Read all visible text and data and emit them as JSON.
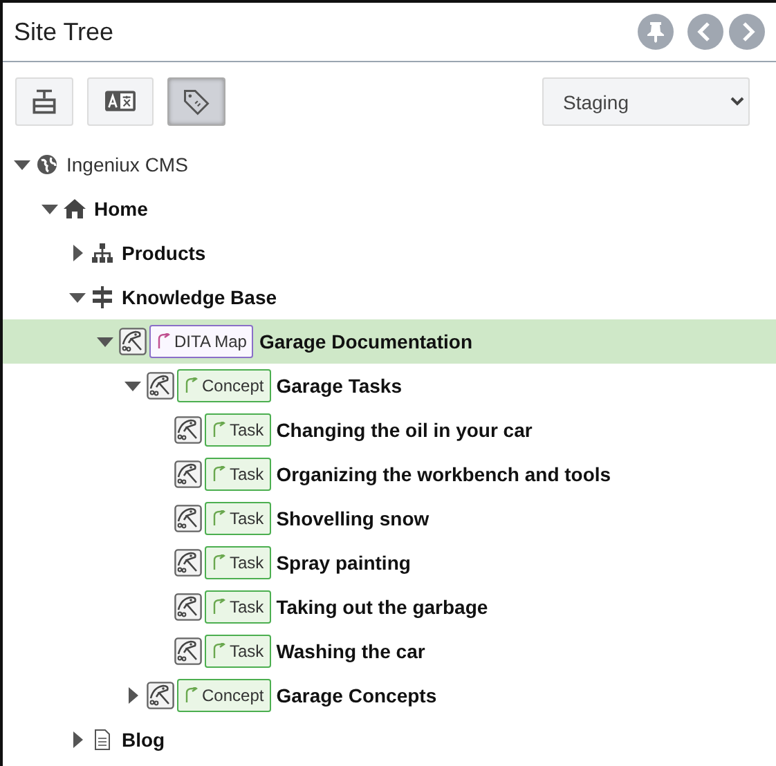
{
  "panel": {
    "title": "Site Tree"
  },
  "toolbar": {
    "buttons": [
      {
        "kind": "structure",
        "selected": false
      },
      {
        "kind": "translate",
        "selected": false
      },
      {
        "kind": "tag",
        "selected": true
      }
    ],
    "environment": {
      "value": "Staging"
    }
  },
  "tree": [
    {
      "label": "Ingeniux CMS",
      "kind": "site",
      "expanded": true,
      "selected": false,
      "children": [
        {
          "label": "Home",
          "kind": "home",
          "expanded": true,
          "selected": false,
          "children": [
            {
              "label": "Products",
              "kind": "sitemap",
              "expanded": false,
              "selected": false
            },
            {
              "label": "Knowledge Base",
              "kind": "signpost",
              "expanded": true,
              "selected": false,
              "children": [
                {
                  "label": "Garage Documentation",
                  "kind": "dita",
                  "badge": {
                    "label": "DITA Map",
                    "kind": "map"
                  },
                  "expanded": true,
                  "selected": true,
                  "children": [
                    {
                      "label": "Garage Tasks",
                      "kind": "dita",
                      "badge": {
                        "label": "Concept",
                        "kind": "topic"
                      },
                      "expanded": true,
                      "selected": false,
                      "children": [
                        {
                          "label": "Changing the oil in your car",
                          "kind": "dita",
                          "badge": {
                            "label": "Task",
                            "kind": "topic"
                          },
                          "selected": false
                        },
                        {
                          "label": "Organizing the workbench and tools",
                          "kind": "dita",
                          "badge": {
                            "label": "Task",
                            "kind": "topic"
                          },
                          "selected": false
                        },
                        {
                          "label": "Shovelling snow",
                          "kind": "dita",
                          "badge": {
                            "label": "Task",
                            "kind": "topic"
                          },
                          "selected": false
                        },
                        {
                          "label": "Spray painting",
                          "kind": "dita",
                          "badge": {
                            "label": "Task",
                            "kind": "topic"
                          },
                          "selected": false
                        },
                        {
                          "label": "Taking out the garbage",
                          "kind": "dita",
                          "badge": {
                            "label": "Task",
                            "kind": "topic"
                          },
                          "selected": false
                        },
                        {
                          "label": "Washing the car",
                          "kind": "dita",
                          "badge": {
                            "label": "Task",
                            "kind": "topic"
                          },
                          "selected": false
                        }
                      ]
                    },
                    {
                      "label": "Garage Concepts",
                      "kind": "dita",
                      "badge": {
                        "label": "Concept",
                        "kind": "topic"
                      },
                      "expanded": false,
                      "selected": false
                    }
                  ]
                }
              ]
            },
            {
              "label": "Blog",
              "kind": "file",
              "expanded": false,
              "selected": false
            }
          ]
        }
      ]
    }
  ]
}
